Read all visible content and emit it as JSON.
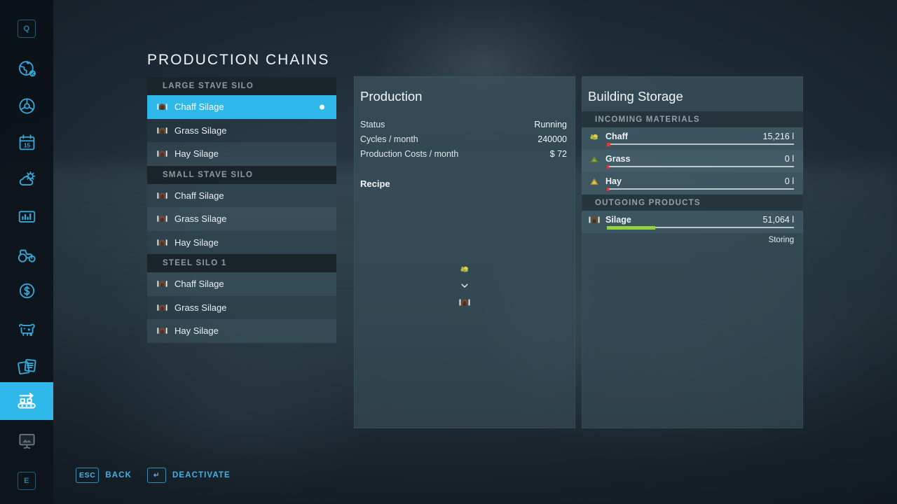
{
  "page": {
    "title": "PRODUCTION CHAINS"
  },
  "colors": {
    "accent": "#2fb9ea",
    "accent_text": "#3fb3e3",
    "panel_bg": "#3a505a",
    "group_header_bg": "#1b2429",
    "bar_low": "#e8372c",
    "bar_good": "#92d13d",
    "text_primary": "#eef4f7",
    "text_muted": "#8d9ba2"
  },
  "sidebar": {
    "items": [
      {
        "name": "help-key",
        "icon": "key-q-badge",
        "key": "Q",
        "active": false,
        "dimmed": false
      },
      {
        "name": "map",
        "icon": "globe-icon",
        "active": false,
        "dimmed": false
      },
      {
        "name": "vehicles",
        "icon": "steering-wheel-icon",
        "active": false,
        "dimmed": false
      },
      {
        "name": "calendar",
        "icon": "calendar-icon",
        "day": "15",
        "active": false,
        "dimmed": false
      },
      {
        "name": "weather",
        "icon": "weather-icon",
        "active": false,
        "dimmed": false
      },
      {
        "name": "statistics",
        "icon": "chart-icon",
        "active": false,
        "dimmed": false
      },
      {
        "name": "vehicle-shop",
        "icon": "tractor-icon",
        "active": false,
        "dimmed": false
      },
      {
        "name": "finances",
        "icon": "dollar-coin-icon",
        "active": false,
        "dimmed": false
      },
      {
        "name": "animals",
        "icon": "cow-icon",
        "active": false,
        "dimmed": false
      },
      {
        "name": "contracts",
        "icon": "documents-icon",
        "active": false,
        "dimmed": false
      },
      {
        "name": "production",
        "icon": "conveyor-belt-icon",
        "active": true,
        "dimmed": false
      },
      {
        "name": "gallery",
        "icon": "picture-board-icon",
        "active": false,
        "dimmed": true
      },
      {
        "name": "exit-key",
        "icon": "key-e-badge",
        "key": "E",
        "active": false,
        "dimmed": true
      }
    ]
  },
  "chain_list": {
    "groups": [
      {
        "title": "LARGE STAVE SILO",
        "items": [
          {
            "label": "Chaff Silage",
            "icon": "silage-bunker-icon",
            "selected": true,
            "has_dot": true
          },
          {
            "label": "Grass Silage",
            "icon": "silage-bunker-icon",
            "selected": false,
            "has_dot": false
          },
          {
            "label": "Hay Silage",
            "icon": "silage-bunker-icon",
            "selected": false,
            "has_dot": false
          }
        ]
      },
      {
        "title": "SMALL STAVE SILO",
        "items": [
          {
            "label": "Chaff Silage",
            "icon": "silage-bunker-icon",
            "selected": false,
            "has_dot": false
          },
          {
            "label": "Grass Silage",
            "icon": "silage-bunker-icon",
            "selected": false,
            "has_dot": false
          },
          {
            "label": "Hay Silage",
            "icon": "silage-bunker-icon",
            "selected": false,
            "has_dot": false
          }
        ]
      },
      {
        "title": "STEEL SILO 1",
        "items": [
          {
            "label": "Chaff Silage",
            "icon": "silage-bunker-icon",
            "selected": false,
            "has_dot": false
          },
          {
            "label": "Grass Silage",
            "icon": "silage-bunker-icon",
            "selected": false,
            "has_dot": false
          },
          {
            "label": "Hay Silage",
            "icon": "silage-bunker-icon",
            "selected": false,
            "has_dot": false
          }
        ]
      }
    ]
  },
  "production": {
    "title": "Production",
    "stats": [
      {
        "label": "Status",
        "value": "Running"
      },
      {
        "label": "Cycles / month",
        "value": "240000"
      },
      {
        "label": "Production Costs / month",
        "value": "$ 72"
      }
    ],
    "recipe_label": "Recipe",
    "recipe": {
      "input_icon": "chaff-icon",
      "arrow_icon": "chevron-down-icon",
      "output_icon": "silage-bunker-icon"
    }
  },
  "storage": {
    "title": "Building Storage",
    "sections": [
      {
        "title": "INCOMING MATERIALS",
        "rows": [
          {
            "name": "Chaff",
            "icon": "chaff-icon",
            "amount": "15,216 l",
            "fill_pct": 2,
            "fill_color": "#e8372c",
            "status": ""
          },
          {
            "name": "Grass",
            "icon": "grass-icon",
            "amount": "0 l",
            "fill_pct": 1,
            "fill_color": "#e8372c",
            "status": ""
          },
          {
            "name": "Hay",
            "icon": "hay-icon",
            "amount": "0 l",
            "fill_pct": 1,
            "fill_color": "#e8372c",
            "status": ""
          }
        ]
      },
      {
        "title": "OUTGOING PRODUCTS",
        "rows": [
          {
            "name": "Silage",
            "icon": "silage-bunker-icon",
            "amount": "51,064 l",
            "fill_pct": 26,
            "fill_color": "#92d13d",
            "status": "Storing"
          }
        ]
      }
    ]
  },
  "actions": [
    {
      "key": "ESC",
      "label": "BACK",
      "icon": "esc-key"
    },
    {
      "key": "↵",
      "label": "DEACTIVATE",
      "icon": "enter-key"
    }
  ]
}
